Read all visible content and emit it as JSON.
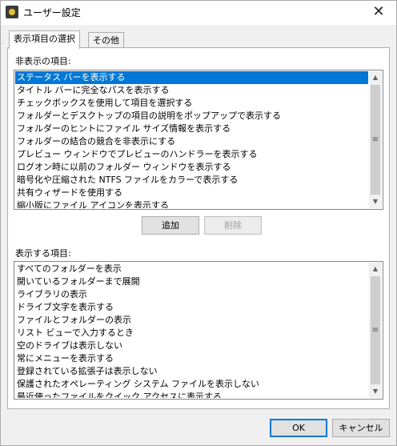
{
  "window": {
    "title": "ユーザー設定",
    "close_symbol": "✕"
  },
  "tabs": [
    {
      "label": "表示項目の選択",
      "active": true
    },
    {
      "label": "その他",
      "active": false
    }
  ],
  "hidden_section": {
    "label": "非表示の項目:",
    "items": [
      "ステータス バーを表示する",
      "タイトル バーに完全なパスを表示する",
      "チェックボックスを使用して項目を選択する",
      "フォルダーとデスクトップの項目の説明をポップアップで表示する",
      "フォルダーのヒントにファイル サイズ情報を表示する",
      "フォルダーの結合の競合を非表示にする",
      "プレビュー ウィンドウでプレビューのハンドラーを表示する",
      "ログオン時に以前のフォルダー ウィンドウを表示する",
      "暗号化や圧縮された NTFS ファイルをカラーで表示する",
      "共有ウィザードを使用する",
      "縮小版にファイル アイコンを表示する"
    ],
    "selected_index": 0
  },
  "buttons": {
    "add": "追加",
    "remove": "削除",
    "ok": "OK",
    "cancel": "キャンセル"
  },
  "shown_section": {
    "label": "表示する項目:",
    "items": [
      "すべてのフォルダーを表示",
      "開いているフォルダーまで展開",
      "ライブラリの表示",
      "ドライブ文字を表示する",
      "ファイルとフォルダーの表示",
      "リスト ビューで入力するとき",
      "空のドライブは表示しない",
      "常にメニューを表示する",
      "登録されている拡張子は表示しない",
      "保護されたオペレーティング システム ファイルを表示しない",
      "最近使ったファイルをクイック アクセスに表示する"
    ]
  },
  "scrollbar": {
    "up_symbol": "▲",
    "down_symbol": "▼",
    "grip_symbol": "≡"
  }
}
